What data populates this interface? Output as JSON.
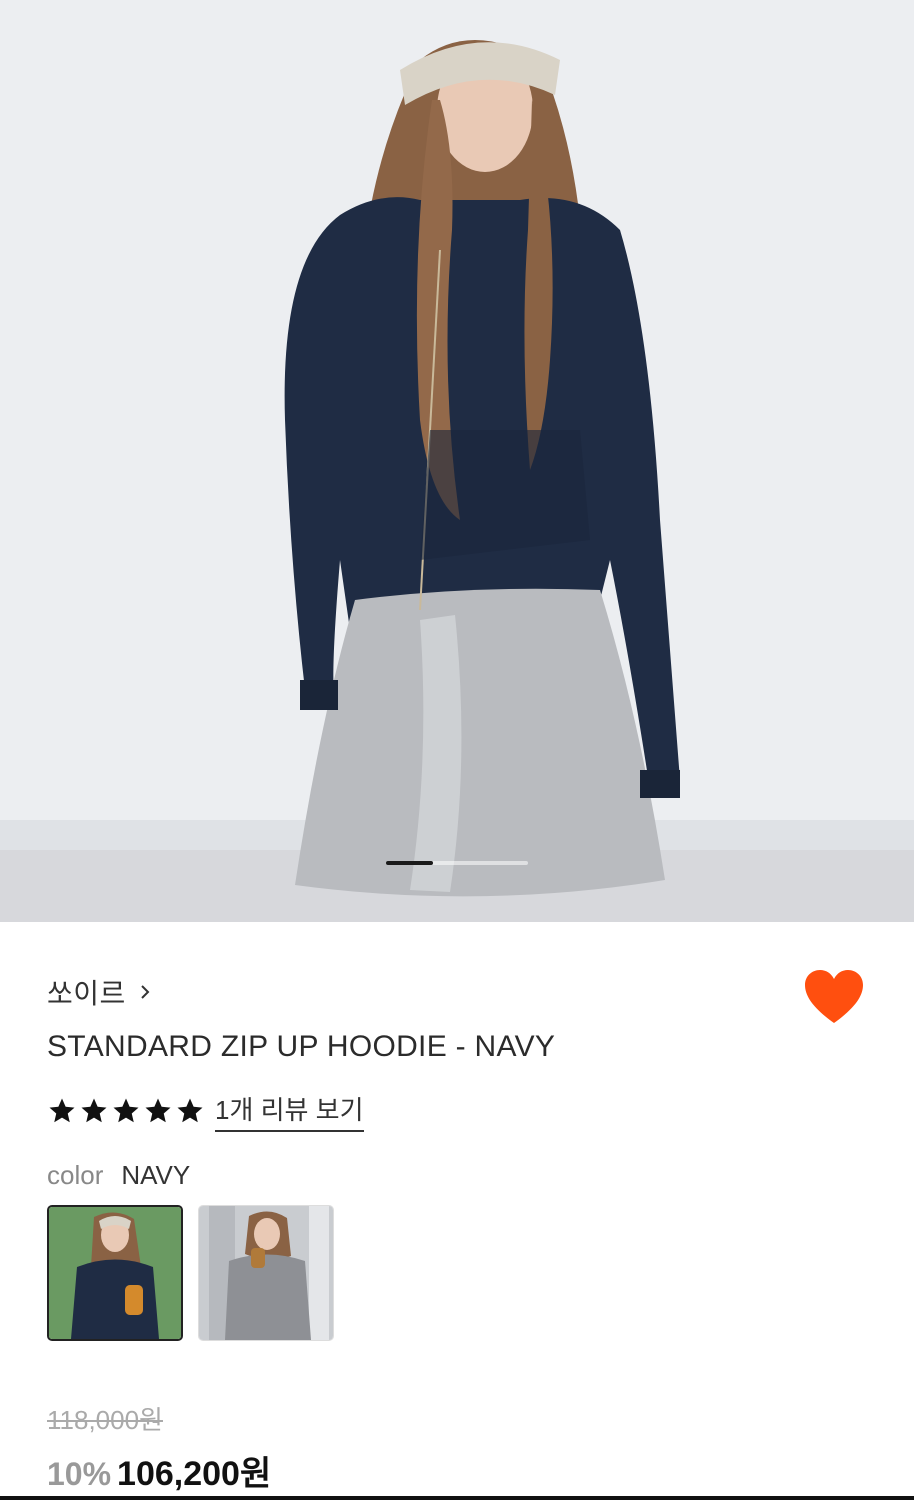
{
  "gallery": {
    "slide_index": 1,
    "slide_progress": 0.33
  },
  "product": {
    "brand": "쏘이르",
    "title": "STANDARD ZIP UP HOODIE - NAVY",
    "rating_stars": 5,
    "review_link": "1개 리뷰 보기",
    "color_label": "color",
    "color_value": "NAVY",
    "wishlisted": true,
    "wish_color": "#ff4f0f",
    "swatches": [
      {
        "name": "NAVY",
        "selected": true,
        "bg": "#6a9a62"
      },
      {
        "name": "GREY",
        "selected": false,
        "bg": "#c9ccd0"
      }
    ],
    "original_price": "118,000원",
    "discount": "10%",
    "sale_price": "106,200원"
  },
  "icons": {
    "chevron": "chevron-right-icon",
    "heart": "heart-icon",
    "star": "star-icon"
  }
}
